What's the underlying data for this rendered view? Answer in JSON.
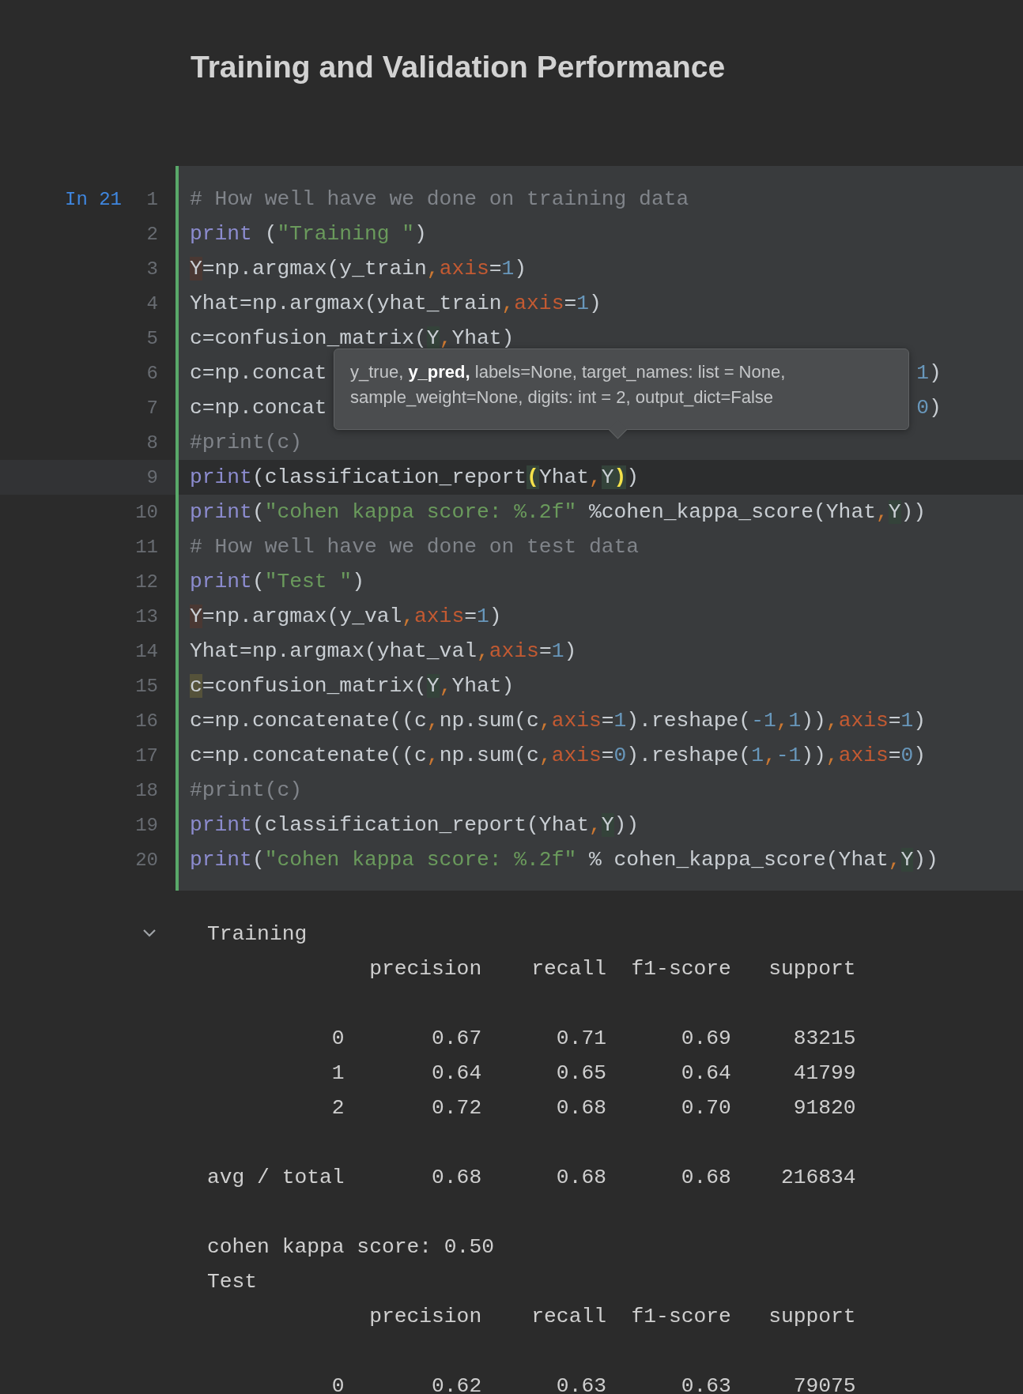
{
  "heading": "Training and Validation Performance",
  "cell": {
    "prompt": "In 21",
    "lines": [
      {
        "number": "1",
        "current": false,
        "tokens": [
          {
            "t": "# How well have we done on training data",
            "kind": "comment"
          }
        ]
      },
      {
        "number": "2",
        "current": false,
        "tokens": [
          {
            "t": "print",
            "kind": "keyword"
          },
          {
            "t": " (",
            "kind": "plain"
          },
          {
            "t": "\"Training \"",
            "kind": "string"
          },
          {
            "t": ")",
            "kind": "plain"
          }
        ]
      },
      {
        "number": "3",
        "current": false,
        "tokens": [
          {
            "t": "Y",
            "kind": "write_ref"
          },
          {
            "t": "=np.argmax(y_train",
            "kind": "plain"
          },
          {
            "t": ",",
            "kind": "comma"
          },
          {
            "t": "axis",
            "kind": "param"
          },
          {
            "t": "=",
            "kind": "plain"
          },
          {
            "t": "1",
            "kind": "number"
          },
          {
            "t": ")",
            "kind": "plain"
          }
        ]
      },
      {
        "number": "4",
        "current": false,
        "tokens": [
          {
            "t": "Yhat=np.argmax(yhat_train",
            "kind": "plain"
          },
          {
            "t": ",",
            "kind": "comma"
          },
          {
            "t": "axis",
            "kind": "param"
          },
          {
            "t": "=",
            "kind": "plain"
          },
          {
            "t": "1",
            "kind": "number"
          },
          {
            "t": ")",
            "kind": "plain"
          }
        ]
      },
      {
        "number": "5",
        "current": false,
        "tokens": [
          {
            "t": "c=confusion_matrix(",
            "kind": "plain"
          },
          {
            "t": "Y",
            "kind": "read_ref"
          },
          {
            "t": ",",
            "kind": "comma"
          },
          {
            "t": "Yhat)",
            "kind": "plain"
          }
        ]
      },
      {
        "number": "6",
        "current": false,
        "tokens": [
          {
            "t": "c=np.concat",
            "kind": "plain"
          }
        ],
        "tail": [
          {
            "t": "1",
            "kind": "number"
          },
          {
            "t": ")",
            "kind": "plain"
          }
        ]
      },
      {
        "number": "7",
        "current": false,
        "tokens": [
          {
            "t": "c=np.concat",
            "kind": "plain"
          }
        ],
        "tail": [
          {
            "t": "0",
            "kind": "number"
          },
          {
            "t": ")",
            "kind": "plain"
          }
        ]
      },
      {
        "number": "8",
        "current": false,
        "tokens": [
          {
            "t": "#print(c)",
            "kind": "comment"
          }
        ]
      },
      {
        "number": "9",
        "current": true,
        "tokens": [
          {
            "t": "print",
            "kind": "keyword"
          },
          {
            "t": "(classification_report",
            "kind": "plain"
          },
          {
            "t": "(",
            "kind": "brace_match"
          },
          {
            "t": "Yhat",
            "kind": "plain"
          },
          {
            "t": ",",
            "kind": "comma"
          },
          {
            "t": "Y",
            "kind": "read_ref",
            "caret": true
          },
          {
            "t": ")",
            "kind": "brace_match"
          },
          {
            "t": ")",
            "kind": "plain"
          }
        ]
      },
      {
        "number": "10",
        "current": false,
        "tokens": [
          {
            "t": "print",
            "kind": "keyword"
          },
          {
            "t": "(",
            "kind": "plain"
          },
          {
            "t": "\"cohen kappa score: %.2f\"",
            "kind": "string"
          },
          {
            "t": " %cohen_kappa_score(Yhat",
            "kind": "plain"
          },
          {
            "t": ",",
            "kind": "comma"
          },
          {
            "t": "Y",
            "kind": "read_ref"
          },
          {
            "t": "))",
            "kind": "plain"
          }
        ]
      },
      {
        "number": "11",
        "current": false,
        "tokens": [
          {
            "t": "# How well have we done on test data",
            "kind": "comment"
          }
        ]
      },
      {
        "number": "12",
        "current": false,
        "tokens": [
          {
            "t": "print",
            "kind": "keyword"
          },
          {
            "t": "(",
            "kind": "plain"
          },
          {
            "t": "\"Test \"",
            "kind": "string"
          },
          {
            "t": ")",
            "kind": "plain"
          }
        ]
      },
      {
        "number": "13",
        "current": false,
        "tokens": [
          {
            "t": "Y",
            "kind": "write_ref"
          },
          {
            "t": "=np.argmax(y_val",
            "kind": "plain"
          },
          {
            "t": ",",
            "kind": "comma"
          },
          {
            "t": "axis",
            "kind": "param"
          },
          {
            "t": "=",
            "kind": "plain"
          },
          {
            "t": "1",
            "kind": "number"
          },
          {
            "t": ")",
            "kind": "plain"
          }
        ]
      },
      {
        "number": "14",
        "current": false,
        "tokens": [
          {
            "t": "Yhat=np.argmax(yhat_val",
            "kind": "plain"
          },
          {
            "t": ",",
            "kind": "comma"
          },
          {
            "t": "axis",
            "kind": "param"
          },
          {
            "t": "=",
            "kind": "plain"
          },
          {
            "t": "1",
            "kind": "number"
          },
          {
            "t": ")",
            "kind": "plain"
          }
        ]
      },
      {
        "number": "15",
        "current": false,
        "tokens": [
          {
            "t": "c",
            "kind": "usage_ref"
          },
          {
            "t": "=confusion_matrix(",
            "kind": "plain"
          },
          {
            "t": "Y",
            "kind": "read_ref"
          },
          {
            "t": ",",
            "kind": "comma"
          },
          {
            "t": "Yhat)",
            "kind": "plain"
          }
        ]
      },
      {
        "number": "16",
        "current": false,
        "tokens": [
          {
            "t": "c=np.concatenate((c",
            "kind": "plain"
          },
          {
            "t": ",",
            "kind": "comma"
          },
          {
            "t": "np.sum(c",
            "kind": "plain"
          },
          {
            "t": ",",
            "kind": "comma"
          },
          {
            "t": "axis",
            "kind": "param"
          },
          {
            "t": "=",
            "kind": "plain"
          },
          {
            "t": "1",
            "kind": "number"
          },
          {
            "t": ").reshape(",
            "kind": "plain"
          },
          {
            "t": "-1",
            "kind": "number"
          },
          {
            "t": ",",
            "kind": "comma"
          },
          {
            "t": "1",
            "kind": "number"
          },
          {
            "t": "))",
            "kind": "plain"
          },
          {
            "t": ",",
            "kind": "comma"
          },
          {
            "t": "axis",
            "kind": "param"
          },
          {
            "t": "=",
            "kind": "plain"
          },
          {
            "t": "1",
            "kind": "number"
          },
          {
            "t": ")",
            "kind": "plain"
          }
        ]
      },
      {
        "number": "17",
        "current": false,
        "tokens": [
          {
            "t": "c=np.concatenate((c",
            "kind": "plain"
          },
          {
            "t": ",",
            "kind": "comma"
          },
          {
            "t": "np.sum(c",
            "kind": "plain"
          },
          {
            "t": ",",
            "kind": "comma"
          },
          {
            "t": "axis",
            "kind": "param"
          },
          {
            "t": "=",
            "kind": "plain"
          },
          {
            "t": "0",
            "kind": "number"
          },
          {
            "t": ").reshape(",
            "kind": "plain"
          },
          {
            "t": "1",
            "kind": "number"
          },
          {
            "t": ",",
            "kind": "comma"
          },
          {
            "t": "-1",
            "kind": "number"
          },
          {
            "t": "))",
            "kind": "plain"
          },
          {
            "t": ",",
            "kind": "comma"
          },
          {
            "t": "axis",
            "kind": "param"
          },
          {
            "t": "=",
            "kind": "plain"
          },
          {
            "t": "0",
            "kind": "number"
          },
          {
            "t": ")",
            "kind": "plain"
          }
        ]
      },
      {
        "number": "18",
        "current": false,
        "tokens": [
          {
            "t": "#print(c)",
            "kind": "comment"
          }
        ]
      },
      {
        "number": "19",
        "current": false,
        "tokens": [
          {
            "t": "print",
            "kind": "keyword"
          },
          {
            "t": "(classification_report(Yhat",
            "kind": "plain"
          },
          {
            "t": ",",
            "kind": "comma"
          },
          {
            "t": "Y",
            "kind": "read_ref"
          },
          {
            "t": "))",
            "kind": "plain"
          }
        ]
      },
      {
        "number": "20",
        "current": false,
        "tokens": [
          {
            "t": "print",
            "kind": "keyword"
          },
          {
            "t": "(",
            "kind": "plain"
          },
          {
            "t": "\"cohen kappa score: %.2f\"",
            "kind": "string"
          },
          {
            "t": " % cohen_kappa_score(Yhat",
            "kind": "plain"
          },
          {
            "t": ",",
            "kind": "comma"
          },
          {
            "t": "Y",
            "kind": "read_ref"
          },
          {
            "t": "))",
            "kind": "plain"
          }
        ]
      }
    ],
    "tooltip": {
      "lines": [
        "y_true, **y_pred,** labels=None, target_names: list = None,",
        "sample_weight=None, digits: int = 2, output_dict=False"
      ]
    }
  },
  "output": {
    "expanded": true,
    "lines": [
      {
        "kind": "text",
        "text": "Training"
      },
      {
        "kind": "text",
        "text": "             precision    recall  f1-score   support"
      },
      {
        "kind": "blank"
      },
      {
        "kind": "text",
        "text": "          0       0.67      0.71      0.69     83215"
      },
      {
        "kind": "text",
        "text": "          1       0.64      0.65      0.64     41799"
      },
      {
        "kind": "text",
        "text": "          2       0.72      0.68      0.70     91820"
      },
      {
        "kind": "blank"
      },
      {
        "kind": "text",
        "text": "avg / total       0.68      0.68      0.68    216834"
      },
      {
        "kind": "blank"
      },
      {
        "kind": "text",
        "text": "cohen kappa score: 0.50"
      },
      {
        "kind": "text",
        "text": "Test"
      },
      {
        "kind": "text",
        "text": "             precision    recall  f1-score   support"
      },
      {
        "kind": "blank"
      },
      {
        "kind": "text",
        "text": "          0       0.62      0.63      0.63     79075"
      }
    ]
  }
}
